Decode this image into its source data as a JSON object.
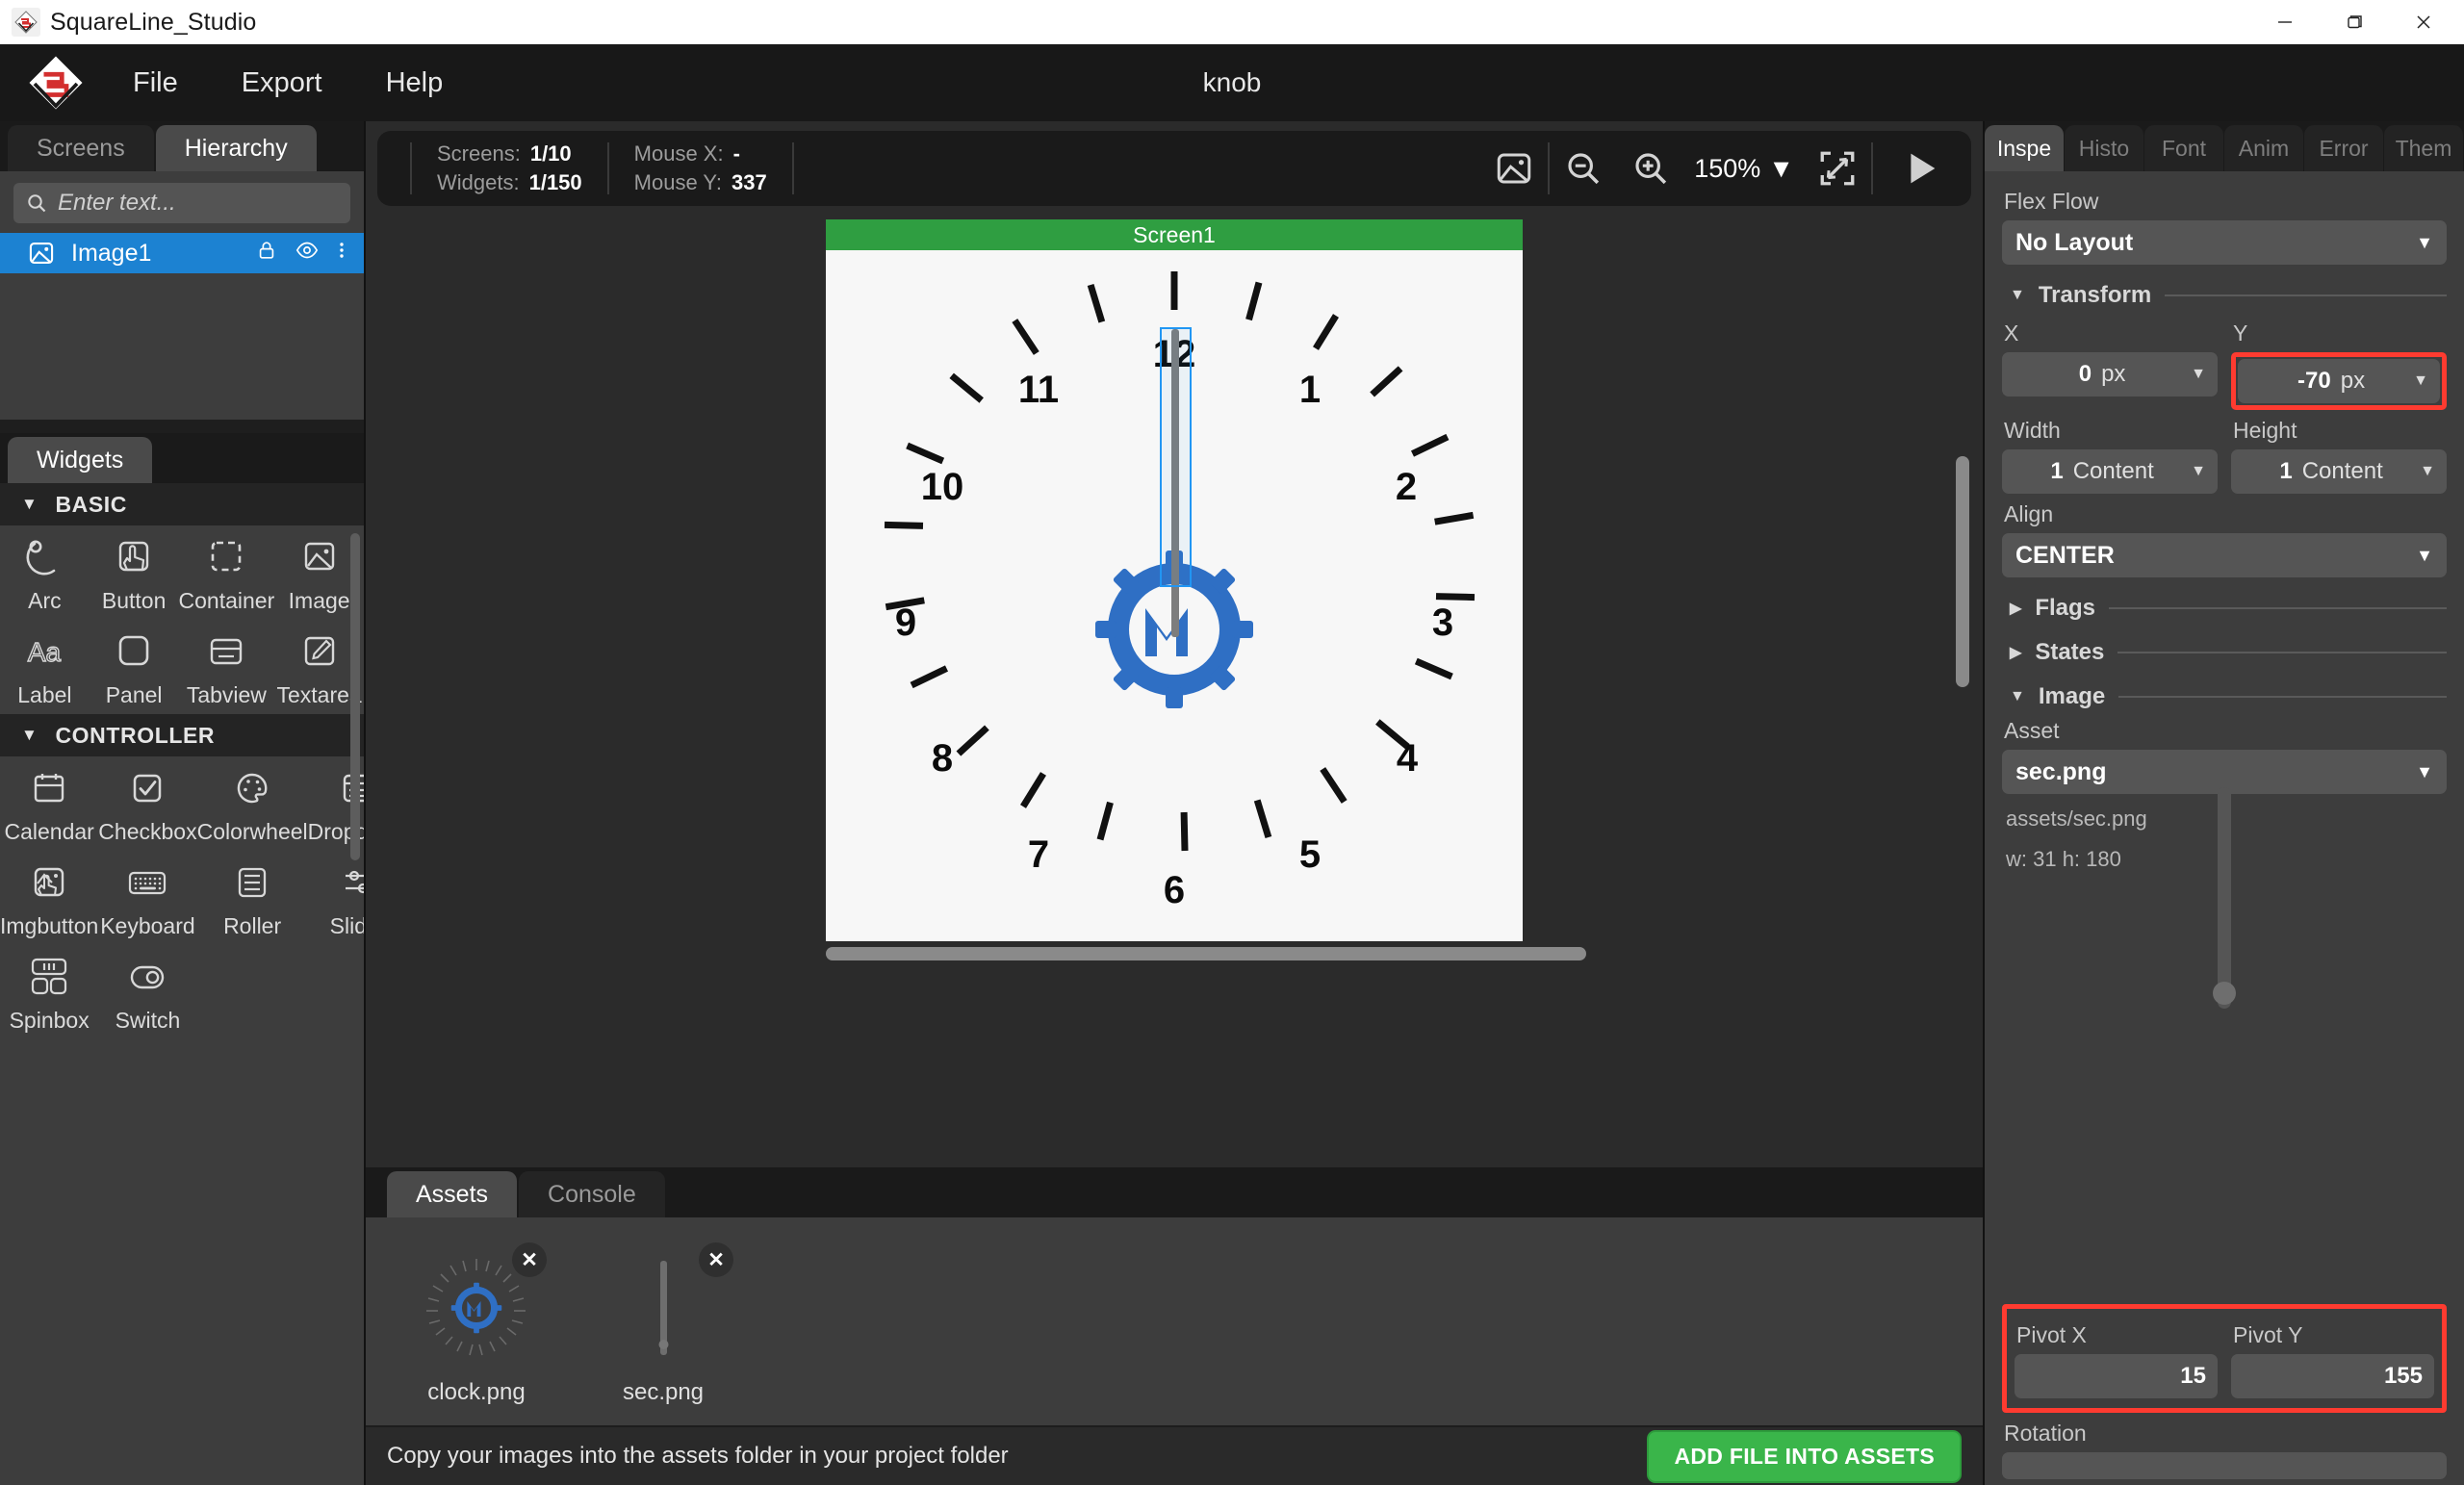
{
  "window": {
    "title": "SquareLine_Studio",
    "minimize_label": "–",
    "maximize_label": "❐",
    "close_label": "✕"
  },
  "menubar": {
    "items": [
      "File",
      "Export",
      "Help"
    ],
    "project_name": "knob"
  },
  "left_panel": {
    "tabs": [
      {
        "label": "Screens",
        "active": false
      },
      {
        "label": "Hierarchy",
        "active": true
      }
    ],
    "search": {
      "placeholder": "Enter text...",
      "value": ""
    },
    "tree": [
      {
        "label": "Image1",
        "selected": true,
        "icon": "image-icon"
      }
    ],
    "widgets_tab": {
      "label": "Widgets",
      "active": true
    },
    "sections": [
      {
        "title": "BASIC",
        "expanded": true,
        "items": [
          {
            "label": "Arc",
            "icon": "arc-icon"
          },
          {
            "label": "Button",
            "icon": "button-icon"
          },
          {
            "label": "Container",
            "icon": "container-icon"
          },
          {
            "label": "Image",
            "icon": "image-icon"
          },
          {
            "label": "Label",
            "icon": "label-icon"
          },
          {
            "label": "Panel",
            "icon": "panel-icon"
          },
          {
            "label": "Tabview",
            "icon": "tabview-icon"
          },
          {
            "label": "Textarea",
            "icon": "textarea-icon"
          }
        ]
      },
      {
        "title": "CONTROLLER",
        "expanded": true,
        "items": [
          {
            "label": "Calendar",
            "icon": "calendar-icon"
          },
          {
            "label": "Checkbox",
            "icon": "checkbox-icon"
          },
          {
            "label": "Colorwheel",
            "icon": "colorwheel-icon"
          },
          {
            "label": "Dropdown",
            "icon": "dropdown-icon"
          },
          {
            "label": "Imgbutton",
            "icon": "imgbutton-icon"
          },
          {
            "label": "Keyboard",
            "icon": "keyboard-icon"
          },
          {
            "label": "Roller",
            "icon": "roller-icon"
          },
          {
            "label": "Slider",
            "icon": "slider-icon"
          },
          {
            "label": "Spinbox",
            "icon": "spinbox-icon"
          },
          {
            "label": "Switch",
            "icon": "switch-icon"
          }
        ]
      }
    ]
  },
  "canvas_toolbar": {
    "screens_label": "Screens:",
    "screens_value": "1/10",
    "widgets_label": "Widgets:",
    "widgets_value": "1/150",
    "mouse_x_label": "Mouse X:",
    "mouse_x_value": "-",
    "mouse_y_label": "Mouse Y:",
    "mouse_y_value": "337",
    "zoom_value": "150%",
    "zoom_caret": "▼"
  },
  "canvas": {
    "screen_name": "Screen1",
    "screen_bar_color": "#2f9e41",
    "background": "#f7f7f7",
    "clock_numerals": [
      "12",
      "1",
      "2",
      "3",
      "4",
      "5",
      "6",
      "7",
      "8",
      "9",
      "10",
      "11"
    ],
    "selection_color": "#2196f3",
    "second_hand_color": "#7d7d7d",
    "logo_color": "#2f6fc4"
  },
  "bottom_panel": {
    "tabs": [
      {
        "label": "Assets",
        "active": true
      },
      {
        "label": "Console",
        "active": false
      }
    ],
    "assets": [
      {
        "name": "clock.png",
        "close_label": "✕",
        "thumb": "clock-thumb"
      },
      {
        "name": "sec.png",
        "close_label": "✕",
        "thumb": "sec-thumb"
      }
    ],
    "status_text": "Copy your images into the assets folder in your project folder",
    "add_button": "ADD FILE INTO ASSETS",
    "add_button_color": "#3ab54a"
  },
  "inspector": {
    "tabs": [
      {
        "label": "Inspe",
        "active": true
      },
      {
        "label": "Histo",
        "active": false
      },
      {
        "label": "Font",
        "active": false
      },
      {
        "label": "Anim",
        "active": false
      },
      {
        "label": "Error",
        "active": false
      },
      {
        "label": "Them",
        "active": false
      }
    ],
    "flex_flow_label": "Flex Flow",
    "flex_flow_value": "No Layout",
    "transform": {
      "title": "Transform",
      "caret": "▼",
      "x_label": "X",
      "x_value": "0",
      "x_unit": "px",
      "y_label": "Y",
      "y_value": "-70",
      "y_unit": "px",
      "y_highlighted": true,
      "width_label": "Width",
      "width_value": "1",
      "width_unit": "Content",
      "height_label": "Height",
      "height_value": "1",
      "height_unit": "Content",
      "align_label": "Align",
      "align_value": "CENTER"
    },
    "flags": {
      "title": "Flags",
      "caret": "▶"
    },
    "states": {
      "title": "States",
      "caret": "▶"
    },
    "image": {
      "title": "Image",
      "caret": "▼",
      "asset_label": "Asset",
      "asset_value": "sec.png",
      "asset_path": "assets/sec.png",
      "asset_dims": "w: 31  h: 180"
    },
    "pivot": {
      "x_label": "Pivot X",
      "x_value": "15",
      "y_label": "Pivot Y",
      "y_value": "155",
      "highlighted": true
    },
    "rotation_label": "Rotation",
    "highlight_color": "#ff3b30"
  }
}
